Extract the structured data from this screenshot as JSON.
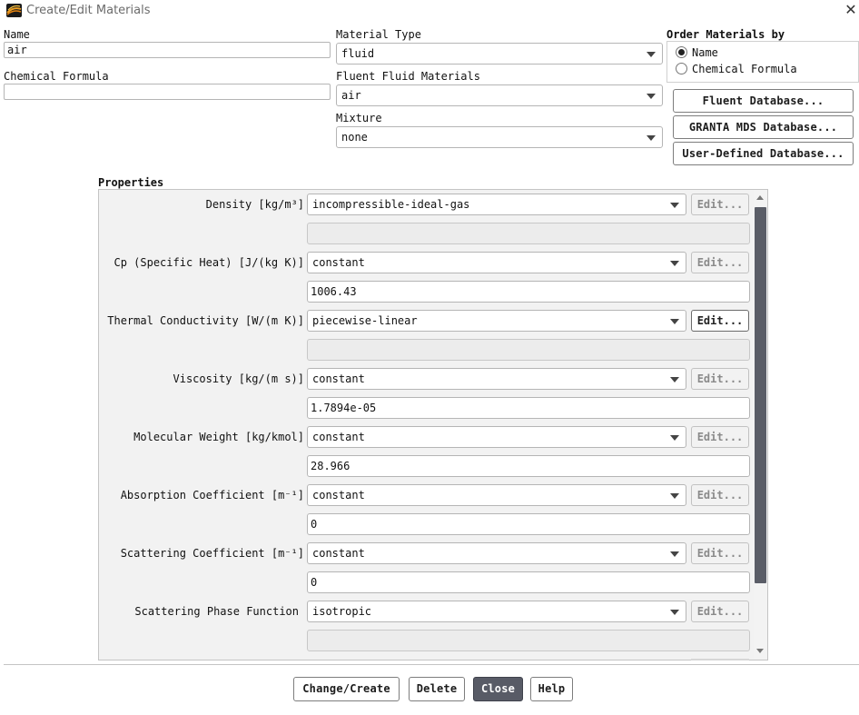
{
  "window": {
    "title": "Create/Edit Materials",
    "close_glyph": "✕",
    "icon": "ansys-fluent-app-icon"
  },
  "name": {
    "label": "Name",
    "value": "air"
  },
  "chemical_formula": {
    "label": "Chemical Formula",
    "value": ""
  },
  "material_type": {
    "label": "Material Type",
    "value": "fluid"
  },
  "fluent_fluid_materials": {
    "label": "Fluent Fluid Materials",
    "value": "air"
  },
  "mixture": {
    "label": "Mixture",
    "value": "none"
  },
  "order_by": {
    "label": "Order Materials by",
    "options": [
      {
        "label": "Name",
        "checked": true
      },
      {
        "label": "Chemical Formula",
        "checked": false
      }
    ]
  },
  "databases": {
    "fluent": "Fluent Database...",
    "granta": "GRANTA MDS Database...",
    "user_defined": "User-Defined Database..."
  },
  "properties": {
    "label": "Properties",
    "edit_label": "Edit...",
    "rows": [
      {
        "label": "Density [kg/m³]",
        "method": "incompressible-ideal-gas",
        "value": "",
        "edit_enabled": false
      },
      {
        "label": "Cp (Specific Heat) [J/(kg K)]",
        "method": "constant",
        "value": "1006.43",
        "edit_enabled": false
      },
      {
        "label": "Thermal Conductivity [W/(m K)]",
        "method": "piecewise-linear",
        "value": "",
        "edit_enabled": true
      },
      {
        "label": "Viscosity [kg/(m s)]",
        "method": "constant",
        "value": "1.7894e-05",
        "edit_enabled": false
      },
      {
        "label": "Molecular Weight [kg/kmol]",
        "method": "constant",
        "value": "28.966",
        "edit_enabled": false
      },
      {
        "label": "Absorption Coefficient [m⁻¹]",
        "method": "constant",
        "value": "0",
        "edit_enabled": false
      },
      {
        "label": "Scattering Coefficient [m⁻¹]",
        "method": "constant",
        "value": "0",
        "edit_enabled": false
      },
      {
        "label": "Scattering Phase Function",
        "method": "isotropic",
        "value": "",
        "edit_enabled": false
      }
    ]
  },
  "footer": {
    "change_create": "Change/Create",
    "delete": "Delete",
    "close": "Close",
    "help": "Help"
  },
  "colors": {
    "primary_button": "#585b66",
    "scrollbar_thumb": "#5a5d67",
    "panel_bg": "#f2f2f2"
  }
}
